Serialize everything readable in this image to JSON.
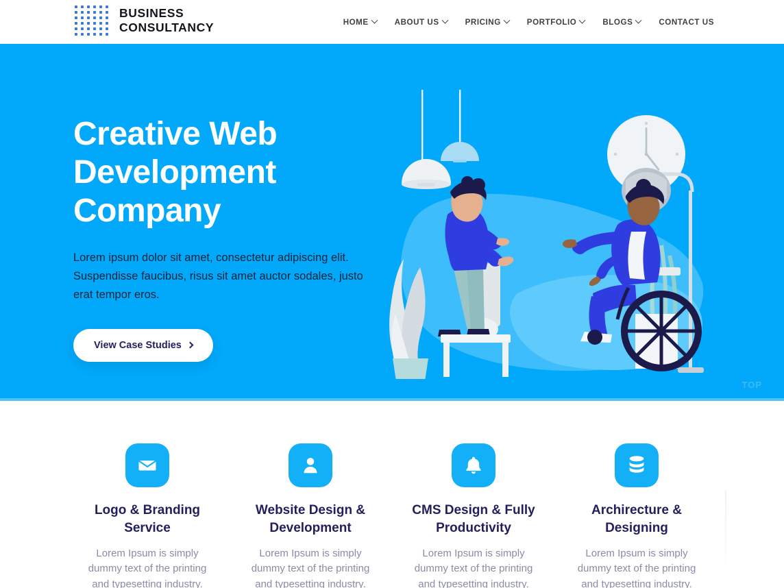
{
  "header": {
    "brand": {
      "line1": "BUSINESS",
      "line2": "CONSULTANCY",
      "dot_color": "#3a7bd5",
      "dot_grid": 6
    },
    "nav": [
      {
        "label": "HOME",
        "has_dropdown": true
      },
      {
        "label": "ABOUT US",
        "has_dropdown": true
      },
      {
        "label": "PRICING",
        "has_dropdown": true
      },
      {
        "label": "PORTFOLIO",
        "has_dropdown": true
      },
      {
        "label": "BLOGS",
        "has_dropdown": true
      },
      {
        "label": "CONTACT US",
        "has_dropdown": false
      }
    ]
  },
  "hero": {
    "background_color": "#02a8f9",
    "title_line1": "Creative Web",
    "title_line2": "Development",
    "title_line3": "Company",
    "subtitle": "Lorem ipsum dolor sit amet, consectetur adipiscing elit. Suspendisse faucibus, risus sit amet auctor sodales, justo erat tempor eros.",
    "cta_label": "View Case Studies",
    "cta_icon": "chevron-right-icon",
    "illustration_alt": "two-people-conversation-office-illustration",
    "scroll_top_label": "TOP"
  },
  "services": {
    "accent_color": "#14b0f7",
    "title_color": "#221f5c",
    "text_color": "#8b8ba7",
    "cards": [
      {
        "icon": "envelope-icon",
        "title": "Logo & Branding Service",
        "text": "Lorem Ipsum is simply dummy text of the printing and typesetting industry."
      },
      {
        "icon": "user-icon",
        "title": "Website Design & Development",
        "text": "Lorem Ipsum is simply dummy text of the printing and typesetting industry."
      },
      {
        "icon": "bell-icon",
        "title": "CMS Design & Fully Productivity",
        "text": "Lorem Ipsum is simply dummy text of the printing and typesetting industry."
      },
      {
        "icon": "database-icon",
        "title": "Archirecture & Designing",
        "text": "Lorem Ipsum is simply dummy text of the printing and typesetting industry."
      }
    ]
  }
}
